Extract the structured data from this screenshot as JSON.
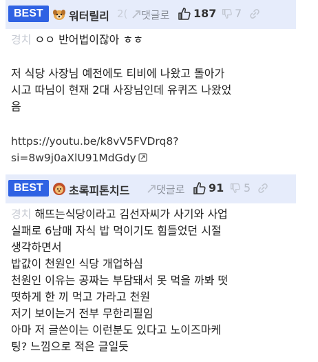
{
  "comments": [
    {
      "badge": "BEST",
      "nickname": "워터릴리",
      "date_fragment": "2(",
      "reply_label": "댓글로",
      "upvotes": "187",
      "downvotes": "7",
      "sub_tag": "경치",
      "first_line": "ㅇㅇ 반어법이잖아 ㅎㅎ",
      "paragraph_lines": [
        "저 식당 사장님 예전에도 티비에 나왔고 돌아가",
        "시고 따님이 현재 2대 사장님인데 유퀴즈 나왔었",
        "음"
      ],
      "url_lines": [
        "https://youtu.be/k8vV5FVDrq8?",
        "si=8w9j0aXlU91MdGdy"
      ]
    },
    {
      "badge": "BEST",
      "nickname": "초록피톤치드",
      "reply_label": "댓글로",
      "upvotes": "91",
      "downvotes": "5",
      "sub_tag": "경치",
      "lines": [
        "해뜨는식당이라고 김선자씨가 사기와 사업",
        "실패로 6남매 자식 밥 먹이기도 힘들었던 시절",
        "생각하면서",
        "밥값이 천원인 식당 개업하심",
        "천원인 이유는 공짜는 부담돼서 못 먹을 까봐 떳",
        "떳하게 한 끼 먹고 가라고 천원",
        "저기 보이는거 전부 무한리필임",
        "아마 저 글쓴이는 이런분도 있다고 노이즈마케",
        "팅? 느낌으로 적은 글일듯"
      ]
    }
  ],
  "colors": {
    "badge": "#2f62e3",
    "header_bg": "#e6ecfb"
  }
}
